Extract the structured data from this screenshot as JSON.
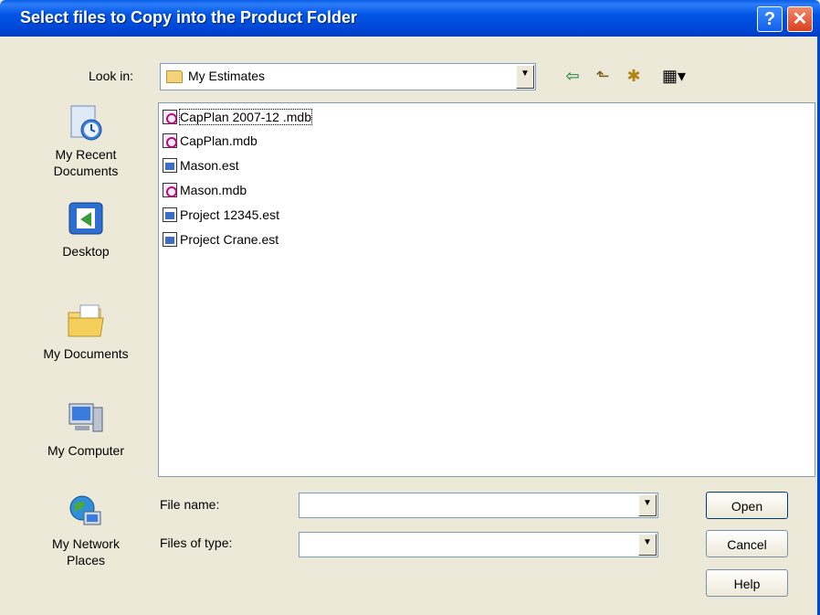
{
  "window": {
    "title": "Select files to Copy into the Product Folder",
    "help_button": "?",
    "close_button": "✕"
  },
  "look_in": {
    "label": "Look in:",
    "value": "My Estimates"
  },
  "toolbar": {
    "back": "⇦",
    "up_one_level": "⬑",
    "new_folder": "✱",
    "views": "▦▾"
  },
  "places": [
    {
      "label": "My Recent Documents",
      "icon": "recent-documents-icon"
    },
    {
      "label": "Desktop",
      "icon": "desktop-icon"
    },
    {
      "label": "My Documents",
      "icon": "my-documents-icon"
    },
    {
      "label": "My Computer",
      "icon": "my-computer-icon"
    },
    {
      "label": "My Network Places",
      "icon": "network-places-icon"
    }
  ],
  "files": [
    {
      "name": "CapPlan 2007-12 .mdb",
      "type": "mdb",
      "selected": true
    },
    {
      "name": "CapPlan.mdb",
      "type": "mdb"
    },
    {
      "name": "Mason.est",
      "type": "est"
    },
    {
      "name": "Mason.mdb",
      "type": "mdb"
    },
    {
      "name": "Project 12345.est",
      "type": "est"
    },
    {
      "name": "Project Crane.est",
      "type": "est"
    }
  ],
  "file_name": {
    "label": "File name:",
    "value": ""
  },
  "file_type": {
    "label": "Files of type:",
    "value": ""
  },
  "buttons": {
    "open": "Open",
    "cancel": "Cancel",
    "help": "Help"
  }
}
